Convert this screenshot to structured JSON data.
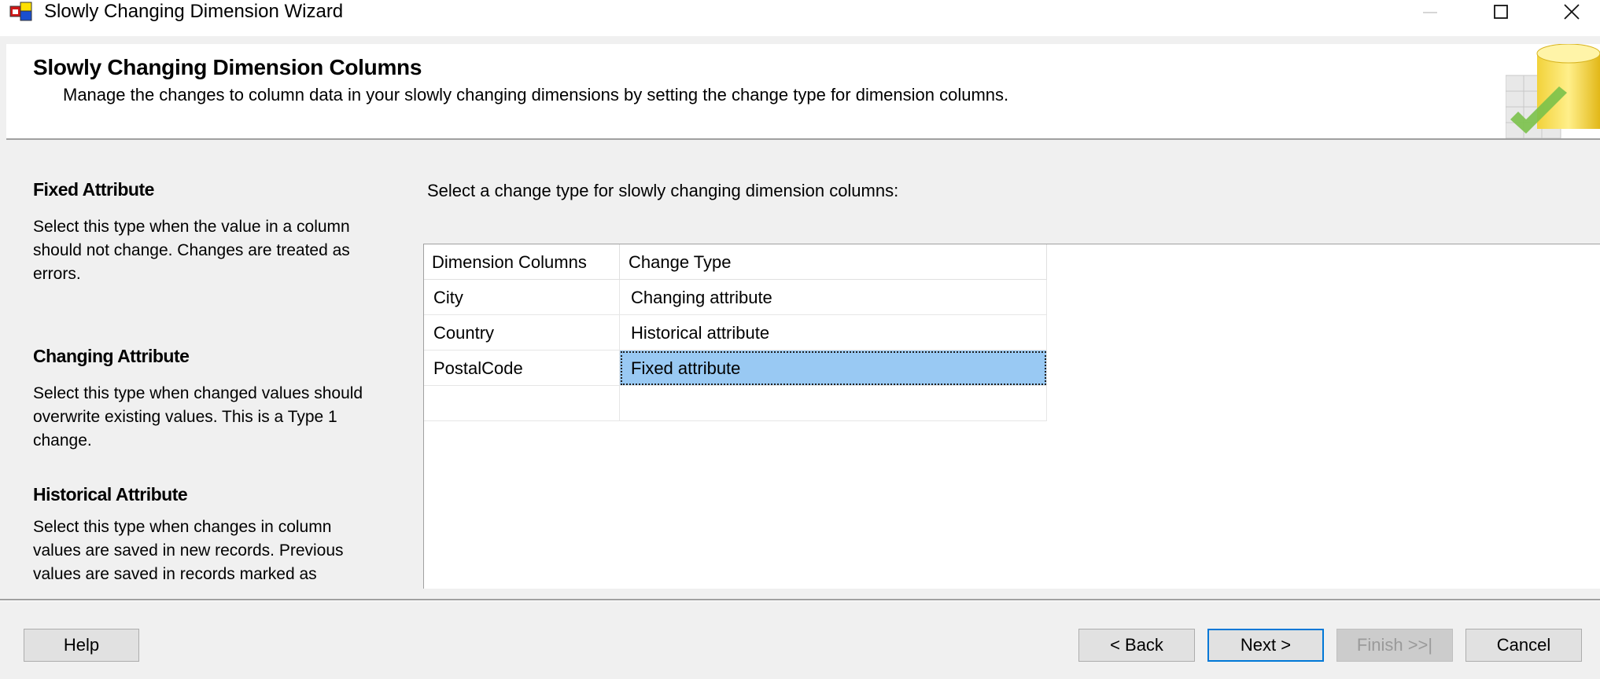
{
  "window": {
    "title": "Slowly Changing Dimension Wizard"
  },
  "header": {
    "title": "Slowly Changing Dimension Columns",
    "subtitle": "Manage the changes to column data in your slowly changing dimensions by setting the change type for dimension columns."
  },
  "descriptions": [
    {
      "title": "Fixed Attribute",
      "text": "Select this type when the value in a column should not change. Changes are treated as errors."
    },
    {
      "title": "Changing Attribute",
      "text": "Select this type when changed values should overwrite existing values. This is a Type 1 change."
    },
    {
      "title": "Historical Attribute",
      "text": "Select this type when changes in column values are saved in new records. Previous values are saved in records marked as"
    }
  ],
  "instruction": "Select a change type for slowly changing dimension columns:",
  "grid": {
    "headers": [
      "Dimension Columns",
      "Change Type"
    ],
    "rows": [
      {
        "column": "City",
        "change_type": "Changing attribute"
      },
      {
        "column": "Country",
        "change_type": "Historical attribute"
      },
      {
        "column": "PostalCode",
        "change_type": "Fixed attribute"
      },
      {
        "column": "",
        "change_type": ""
      }
    ],
    "selected_row": 2
  },
  "buttons": {
    "help": "Help",
    "back": "< Back",
    "next": "Next >",
    "finish": "Finish >>|",
    "cancel": "Cancel"
  },
  "icons": {
    "app": "wizard-app-icon",
    "minimize": "minimize-icon",
    "maximize": "maximize-icon",
    "close": "close-icon",
    "header": "database-check-icon"
  },
  "colors": {
    "selection": "#99c9f3",
    "default_button_border": "#0078d7",
    "disabled_text": "#9a9a9a"
  }
}
